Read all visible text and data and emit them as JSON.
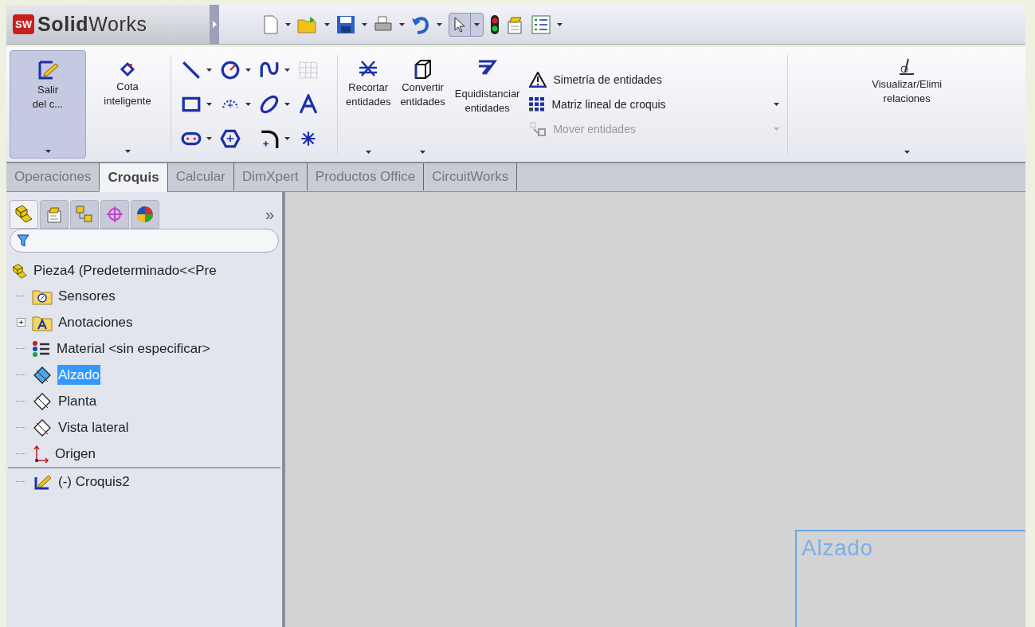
{
  "app": {
    "badge": "SW",
    "title_bold": "Solid",
    "title_rest": "Works"
  },
  "quick_access": {
    "select_active": true
  },
  "ribbon": {
    "big_buttons": [
      {
        "lines": [
          "Salir",
          "del c..."
        ],
        "selected": true,
        "kind": "exit"
      },
      {
        "lines": [
          "Cota",
          "inteligente"
        ],
        "selected": false,
        "kind": "dimension"
      }
    ],
    "edit_buttons": [
      {
        "lines": [
          "Recortar",
          "entidades"
        ],
        "kind": "trim",
        "dropdown": true
      },
      {
        "lines": [
          "Convertir",
          "entidades"
        ],
        "kind": "convert",
        "dropdown": true
      },
      {
        "lines": [
          "Equidistanciar",
          "entidades"
        ],
        "kind": "offset",
        "dropdown": false
      }
    ],
    "list": [
      {
        "label": "Simetría de entidades",
        "kind": "mirror",
        "disabled": false,
        "dropdown": false
      },
      {
        "label": "Matriz lineal de croquis",
        "kind": "pattern",
        "disabled": false,
        "dropdown": true
      },
      {
        "label": "Mover entidades",
        "kind": "move",
        "disabled": true,
        "dropdown": true
      }
    ],
    "relations": {
      "lines": [
        "Visualizar/Elimi",
        "relaciones"
      ]
    }
  },
  "tabs": [
    {
      "label": "Operaciones",
      "selected": false
    },
    {
      "label": "Croquis",
      "selected": true
    },
    {
      "label": "Calcular",
      "selected": false
    },
    {
      "label": "DimXpert",
      "selected": false
    },
    {
      "label": "Productos Office",
      "selected": false
    },
    {
      "label": "CircuitWorks",
      "selected": false
    }
  ],
  "panel": {
    "tabs": [
      {
        "kind": "tree",
        "selected": true
      },
      {
        "kind": "property",
        "selected": false
      },
      {
        "kind": "config",
        "selected": false
      },
      {
        "kind": "dimxpert",
        "selected": false
      },
      {
        "kind": "display",
        "selected": false
      }
    ],
    "more": "»",
    "tree": {
      "label": "Pieza4  (Predeterminado<<Pre",
      "kind": "part",
      "children": [
        {
          "label": "Sensores",
          "kind": "sensors",
          "selected": false
        },
        {
          "label": "Anotaciones",
          "kind": "annotations",
          "selected": false,
          "expanded": false
        },
        {
          "label": "Material <sin especificar>",
          "kind": "material",
          "selected": false
        },
        {
          "label": "Alzado",
          "kind": "plane",
          "selected": true
        },
        {
          "label": "Planta",
          "kind": "plane",
          "selected": false
        },
        {
          "label": "Vista lateral",
          "kind": "plane",
          "selected": false
        },
        {
          "label": "Origen",
          "kind": "origin",
          "selected": false
        },
        {
          "label": "(-) Croquis2",
          "kind": "sketch",
          "selected": false
        }
      ]
    }
  },
  "canvas": {
    "plane_label": "Alzado"
  }
}
